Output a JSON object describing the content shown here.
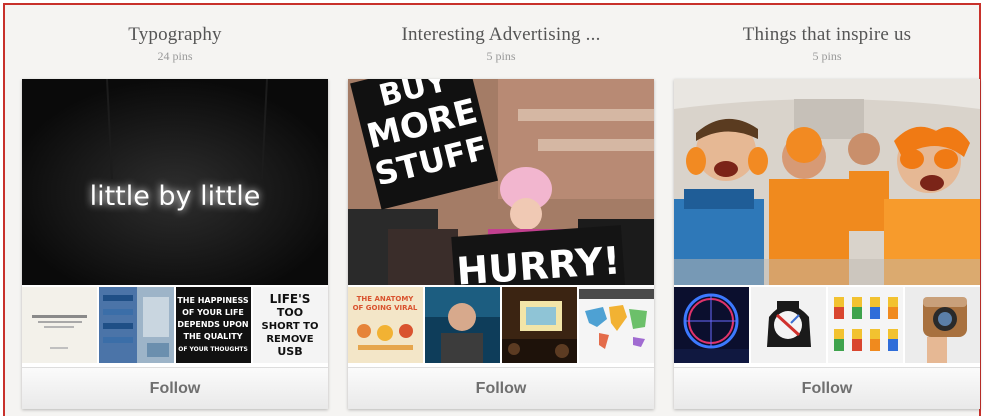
{
  "boards": [
    {
      "title": "Typography",
      "pin_count": "24 pins",
      "cover_text": "little by little",
      "thumbs": [
        {
          "icon": "typography-sample-icon"
        },
        {
          "icon": "blue-pattern-icon"
        },
        {
          "text_lines": [
            "THE HAPPINESS",
            "OF YOUR LIFE",
            "DEPENDS UPON",
            "THE QUALITY",
            "OF YOUR THOUGHTS"
          ]
        },
        {
          "text_lines": [
            "LIFE'S",
            "TOO",
            "SHORT TO",
            "REMOVE",
            "USB"
          ]
        }
      ],
      "follow_label": "Follow"
    },
    {
      "title": "Interesting Advertising ...",
      "pin_count": "5 pins",
      "cover_text_top": [
        "BUY",
        "MORE",
        "STUFF"
      ],
      "cover_text_bottom": "HURRY!",
      "thumbs": [
        {
          "text_lines": [
            "THE ANATOMY",
            "OF GOING VIRAL"
          ]
        },
        {
          "icon": "speaker-portrait-icon"
        },
        {
          "icon": "presentation-room-icon"
        },
        {
          "icon": "world-map-icon"
        }
      ],
      "follow_label": "Follow"
    },
    {
      "title": "Things that inspire us",
      "pin_count": "5 pins",
      "thumbs": [
        {
          "icon": "london-eye-icon"
        },
        {
          "icon": "queen-portrait-icon"
        },
        {
          "icon": "lego-figures-icon"
        },
        {
          "icon": "instagram-camera-icon"
        }
      ],
      "follow_label": "Follow"
    }
  ]
}
